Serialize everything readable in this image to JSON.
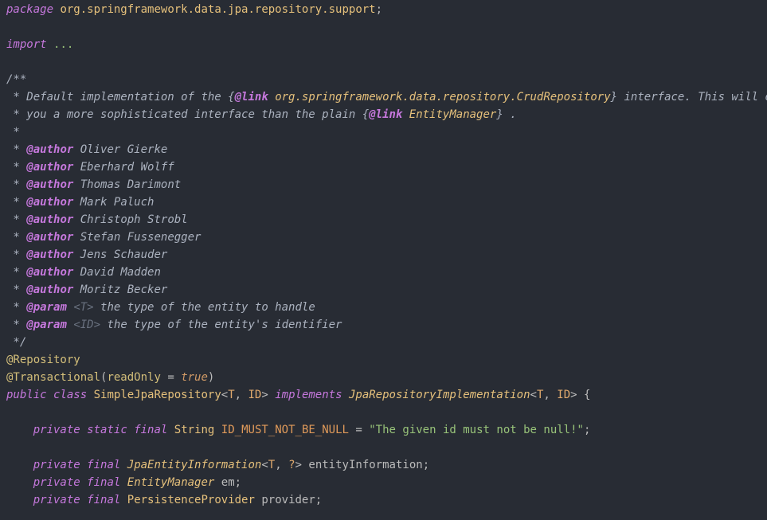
{
  "editor": {
    "package_kw": "package",
    "package_name": "org.springframework.data.jpa.repository.support",
    "semicolon": ";",
    "import_kw": "import",
    "import_dots": "...",
    "javadoc": {
      "open": "/**",
      "star": " * ",
      "desc1_pre": "Default implementation of the ",
      "link_open": "{",
      "link_tag": "@link",
      "link_target_1": "org.springframework.data.repository.CrudRepository",
      "link_close": "}",
      "desc1_post": " interface. This will offer",
      "desc2_pre": "you a more sophisticated interface than the plain ",
      "link_target_2": "EntityManager",
      "desc2_post": " .",
      "empty_star": " *",
      "author_tag": "@author",
      "authors": [
        "Oliver Gierke",
        "Eberhard Wolff",
        "Thomas Darimont",
        "Mark Paluch",
        "Christoph Strobl",
        "Stefan Fussenegger",
        "Jens Schauder",
        "David Madden",
        "Moritz Becker"
      ],
      "param_tag": "@param",
      "params": [
        {
          "name": "<T>",
          "desc": " the type of the entity to handle"
        },
        {
          "name": "<ID>",
          "desc": " the type of the entity's identifier"
        }
      ],
      "close": " */"
    },
    "annotation_repository": "@Repository",
    "annotation_transactional": "@Transactional",
    "transactional_open": "(",
    "transactional_attr": "readOnly",
    "transactional_eq": " = ",
    "transactional_val": "true",
    "transactional_close": ")",
    "class_decl": {
      "public_kw": "public",
      "class_kw": "class",
      "class_name": "SimpleJpaRepository",
      "generics_open": "<",
      "t": "T",
      "comma": ", ",
      "id": "ID",
      "generics_close": ">",
      "implements_kw": "implements",
      "iface_name": "JpaRepositoryImplementation",
      "brace": " {"
    },
    "fields": {
      "private_kw": "private",
      "static_kw": "static",
      "final_kw": "final",
      "string_type": "String",
      "const_name": "ID_MUST_NOT_BE_NULL",
      "assign": " = ",
      "const_value": "\"The given id must not be null!\"",
      "entity_info_type": "JpaEntityInformation",
      "entity_info_generic_open": "<",
      "entity_info_t": "T",
      "entity_info_comma": ", ",
      "entity_info_q": "?",
      "entity_info_generic_close": ">",
      "entity_info_name": "entityInformation",
      "em_type": "EntityManager",
      "em_name": "em",
      "provider_type": "PersistenceProvider",
      "provider_name": "provider"
    }
  }
}
